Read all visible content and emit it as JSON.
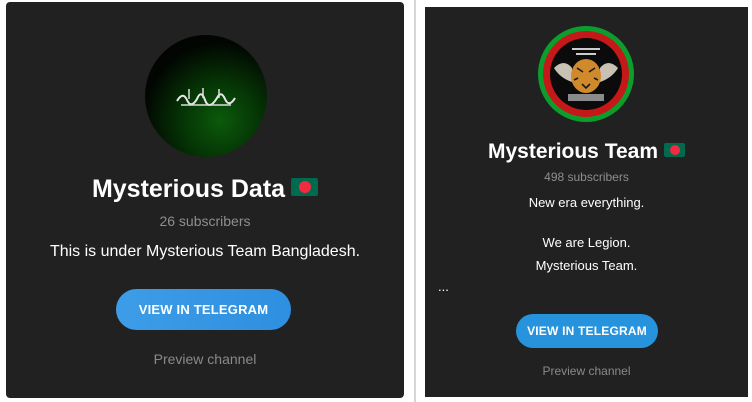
{
  "left_card": {
    "title": "Mysterious Data",
    "subscribers": "26 subscribers",
    "description": "This is under Mysterious Team Bangladesh.",
    "button_label": "VIEW IN TELEGRAM",
    "preview_label": "Preview channel"
  },
  "right_card": {
    "title": "Mysterious Team",
    "subscribers": "498 subscribers",
    "description_lines": [
      "New era everything.",
      "We are Legion.",
      "Mysterious Team.",
      "..."
    ],
    "button_label": "VIEW IN TELEGRAM",
    "preview_label": "Preview channel"
  },
  "colors": {
    "card_background": "#212121",
    "button_blue": "#2a9fe3",
    "muted_text": "#8e8e8e",
    "flag_green": "#006a4e",
    "flag_red": "#f42a41"
  },
  "icons": {
    "left_avatar": "black-flag-avatar",
    "right_avatar": "tiger-emblem-avatar",
    "title_emoji": "bangladesh-flag-icon"
  }
}
